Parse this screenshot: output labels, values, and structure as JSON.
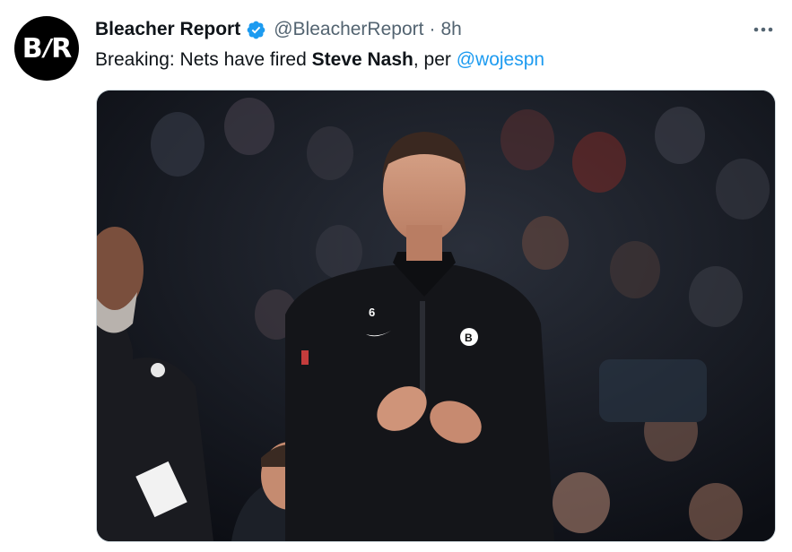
{
  "account": {
    "display_name": "Bleacher Report",
    "handle": "@BleacherReport",
    "separator": "·",
    "timestamp": "8h",
    "avatar_text_left": "B",
    "avatar_text_right": "R",
    "verified": true,
    "verified_color": "#1d9bf0"
  },
  "tweet": {
    "text_prefix": "Breaking: Nets have fired ",
    "text_bold": "Steve Nash",
    "text_middle": ", per ",
    "mention": "@wojespn",
    "mention_color": "#1d9bf0"
  },
  "actions": {
    "more_icon": "more-horizontal-icon"
  },
  "media": {
    "kind": "photo",
    "jersey_number": "6",
    "jersey_logo": "B"
  }
}
